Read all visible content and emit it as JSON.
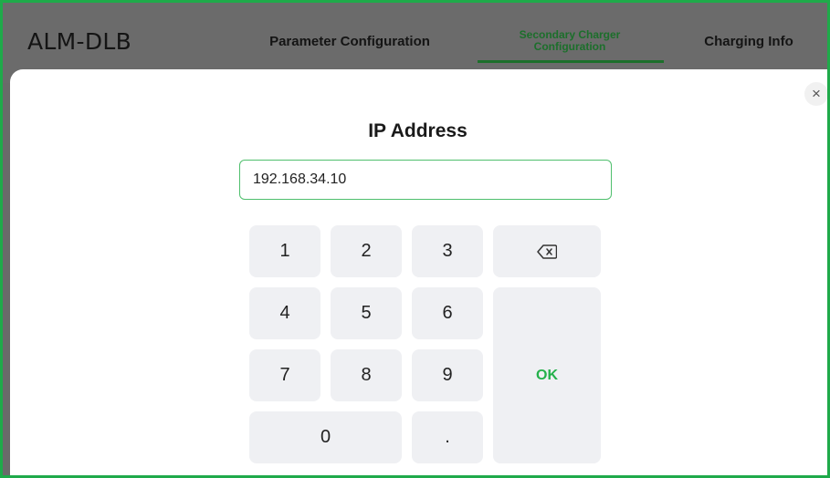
{
  "app": {
    "title": "ALM-DLB"
  },
  "tabs": [
    {
      "label": "Parameter Configuration",
      "active": false
    },
    {
      "label": "Secondary Charger Configuration",
      "active": true
    },
    {
      "label": "Charging Info",
      "active": false
    }
  ],
  "dialog": {
    "title": "IP Address",
    "input_value": "192.168.34.10",
    "close_icon": "×"
  },
  "keypad": {
    "keys": [
      "1",
      "2",
      "3",
      "4",
      "5",
      "6",
      "7",
      "8",
      "9",
      "0",
      "."
    ],
    "ok_label": "OK",
    "backspace_icon": "backspace-icon"
  },
  "colors": {
    "accent": "#24b14b",
    "tab_active": "#1c6f2b",
    "frame_border": "#1faa4a",
    "header_bg": "#6b6b6b",
    "key_bg": "#eff0f3"
  }
}
